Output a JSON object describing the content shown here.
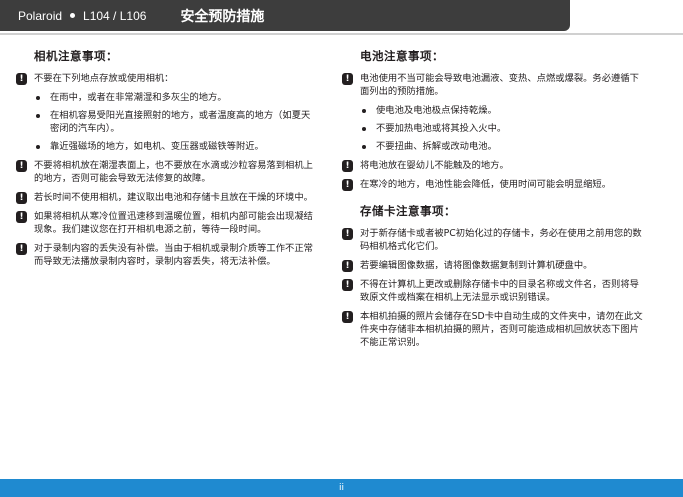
{
  "header": {
    "product": "Polaroid",
    "model": "L104 / L106",
    "title": "安全预防措施"
  },
  "left": {
    "camera_title": "相机注意事项：",
    "camera_intro": "不要在下列地点存放或使用相机：",
    "camera_places": [
      "在雨中，或者在非常潮湿和多灰尘的地方。",
      "在相机容易受阳光直接照射的地方，或者温度高的地方（如夏天密闭的汽车内）。",
      "靠近强磁场的地方，如电机、变压器或磁铁等附近。"
    ],
    "warnings": [
      "不要将相机放在潮湿表面上，也不要放在水滴或沙粒容易落到相机上的地方，否则可能会导致无法修复的故障。",
      "若长时间不使用相机，建议取出电池和存储卡且放在干燥的环境中。",
      "如果将相机从寒冷位置迅速移到温暖位置，相机内部可能会出现凝结现象。我们建议您在打开相机电源之前，等待一段时间。",
      "对于录制内容的丢失没有补偿。当由于相机或录制介质等工作不正常而导致无法播放录制内容时，录制内容丢失，将无法补偿。"
    ]
  },
  "right": {
    "battery_title": "电池注意事项：",
    "battery_intro": "电池使用不当可能会导致电池漏液、变热、点燃或爆裂。务必遵循下面列出的预防措施。",
    "battery_items": [
      "使电池及电池极点保持乾燥。",
      "不要加热电池或将其投入火中。",
      "不要扭曲、拆解或改动电池。"
    ],
    "battery_warnings": [
      "将电池放在婴幼儿不能触及的地方。",
      "在寒冷的地方，电池性能会降低，使用时间可能会明显缩短。"
    ],
    "card_title": "存储卡注意事项：",
    "card_warnings": [
      "对于新存储卡或者被PC初始化过的存储卡，务必在使用之前用您的数码相机格式化它们。",
      "若要编辑图像数据，请将图像数据复制到计算机硬盘中。",
      "不得在计算机上更改或删除存储卡中的目录名称或文件名，否则将导致原文件或档案在相机上无法显示或识别错误。",
      "本相机拍摄的照片会储存在SD卡中自动生成的文件夹中，请勿在此文件夹中存储非本相机拍摄的照片，否则可能造成相机回放状态下图片不能正常识别。"
    ]
  },
  "footer": {
    "page": "ii"
  },
  "colors": {
    "header_bg": "#3d3d3d",
    "footer_bg": "#1f8ad0"
  },
  "icons": {
    "warning": "exclamation-icon",
    "bullet": "bullet-dot"
  }
}
